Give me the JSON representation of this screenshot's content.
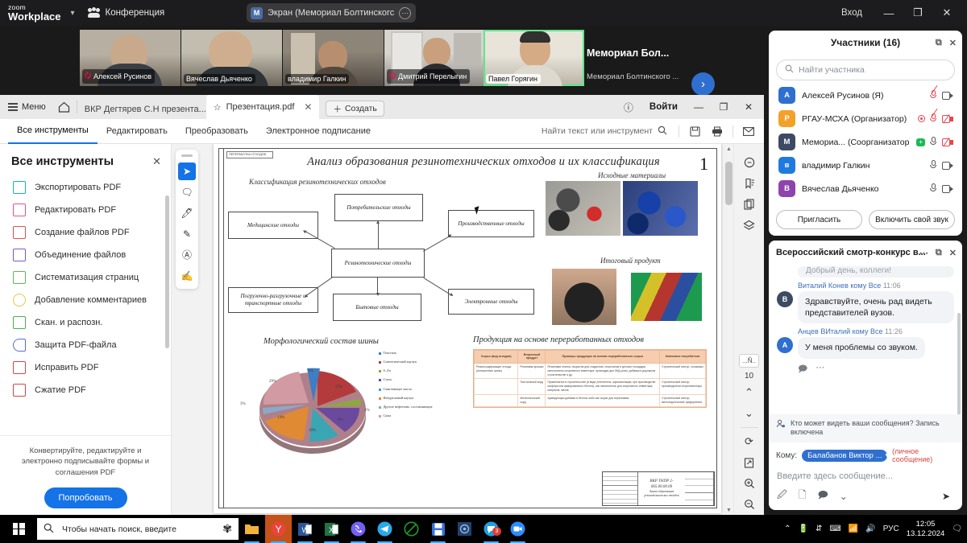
{
  "zoom_app": {
    "brand_line1": "zoom",
    "brand_line2": "Workplace",
    "meeting_label": "Конференция",
    "share_badge": "M",
    "share_label": "Экран (Мемориал Болтинскогс",
    "login_label": "Вход",
    "minimize": "—",
    "restore": "❐",
    "close": "✕",
    "filmstrip": [
      {
        "name": "Алексей Русинов",
        "muted": true,
        "active": false
      },
      {
        "name": "Вячеслав Дьяченко",
        "muted": false,
        "active": false
      },
      {
        "name": "владимир Галкин",
        "muted": false,
        "active": false
      },
      {
        "name": "Дмитрий Перелыгин",
        "muted": true,
        "active": false
      },
      {
        "name": "Павел Горягин",
        "muted": false,
        "active": true
      }
    ],
    "self_tile": {
      "title": "Мемориал  Бол...",
      "subtitle": "Мемориал Болтинского ..."
    },
    "next_arrow": "›"
  },
  "participants": {
    "title": "Участники (16)",
    "popout_icon": "popout-icon",
    "close_icon": "close-icon",
    "search_placeholder": "Найти участника",
    "rows": [
      {
        "initial": "А",
        "color": "#2f6fd0",
        "name": "Алексей Русинов (Я)",
        "recording": false,
        "host_badge": "",
        "mic": "muted",
        "cam": "on"
      },
      {
        "initial": "Р",
        "color": "#f2a12a",
        "name": "РГАУ-МСХА (Организатор)",
        "recording": true,
        "host_badge": "",
        "mic": "muted",
        "cam": "off"
      },
      {
        "initial": "М",
        "color": "#3d4a63",
        "name": "Мемориа...  (Соорганизатор)",
        "recording": false,
        "host_badge": "+",
        "mic": "on",
        "cam": "off"
      },
      {
        "initial": "в",
        "color": "#1f7ae0",
        "name": "владимир Галкин",
        "recording": false,
        "host_badge": "",
        "mic": "on",
        "cam": "on"
      },
      {
        "initial": "В",
        "color": "#8e44ad",
        "name": "Вячеслав Дьяченко",
        "recording": false,
        "host_badge": "",
        "mic": "on",
        "cam": "on"
      }
    ],
    "invite_button": "Пригласить",
    "unmute_button": "Включить свой звук"
  },
  "chat": {
    "title": "Всероссийский смотр-конкурс в...",
    "more_icon": "more-dots-icon",
    "popout_icon": "popout-icon",
    "close_icon": "close-icon",
    "clipped_message": "Добрый день, коллеги!",
    "messages": [
      {
        "author": "Виталий Конев",
        "to": "кому Все",
        "time": "11:06",
        "initial": "В",
        "color": "#3d4a63",
        "text": "Здравствуйте, очень рад видеть представителей вузов."
      },
      {
        "author": "Анцев ВИталий",
        "to": "кому Все",
        "time": "11:26",
        "initial": "А",
        "color": "#2f6fd0",
        "text": "У меня проблемы со звуком."
      }
    ],
    "privacy_note": "Кто может видеть ваши сообщения? Запись включена",
    "to_label": "Кому:",
    "recipient": "Балабанов Виктор ...",
    "private_note": "(личное сообщение)",
    "input_placeholder": "Введите здесь сообщение...",
    "send_icon": "send-icon"
  },
  "acrobat": {
    "menu_label": "Меню",
    "home_icon": "home-icon",
    "tabs": [
      {
        "label": "ВКР Дегтярев С.Н презента...",
        "active": false,
        "starred": false
      },
      {
        "label": "Презентация.pdf",
        "active": true,
        "starred": true
      }
    ],
    "new_button": "Создать",
    "help_icon": "help-icon",
    "signin_label": "Войти",
    "window_minimize": "—",
    "window_restore": "❐",
    "window_close": "✕",
    "toolbar_tabs": [
      {
        "label": "Все инструменты",
        "selected": true
      },
      {
        "label": "Редактировать",
        "selected": false
      },
      {
        "label": "Преобразовать",
        "selected": false
      },
      {
        "label": "Электронное подписание",
        "selected": false
      }
    ],
    "find_placeholder": "Найти текст или инструмент",
    "toolbar_icons": [
      "save-icon",
      "print-icon",
      "mail-icon"
    ],
    "tools_panel": {
      "title": "Все инструменты",
      "close_icon": "close-icon",
      "items": [
        {
          "label": "Экспортировать PDF",
          "color": "#12b5b0",
          "icon": "export-pdf-icon"
        },
        {
          "label": "Редактировать PDF",
          "color": "#e8518d",
          "icon": "edit-pdf-icon"
        },
        {
          "label": "Создание файлов PDF",
          "color": "#e34f4f",
          "icon": "create-pdf-icon"
        },
        {
          "label": "Объединение файлов",
          "color": "#6b5ce7",
          "icon": "combine-files-icon"
        },
        {
          "label": "Систематизация страниц",
          "color": "#5cb85c",
          "icon": "organize-pages-icon"
        },
        {
          "label": "Добавление комментариев",
          "color": "#e8c547",
          "icon": "comment-icon"
        },
        {
          "label": "Скан. и распозн.",
          "color": "#4caf50",
          "icon": "scan-ocr-icon"
        },
        {
          "label": "Защита PDF-файла",
          "color": "#5b6bd6",
          "icon": "protect-pdf-icon"
        },
        {
          "label": "Исправить PDF",
          "color": "#d64545",
          "icon": "fix-pdf-icon"
        },
        {
          "label": "Сжатие PDF",
          "color": "#d64545",
          "icon": "compress-pdf-icon"
        }
      ],
      "promo_text": "Конвертируйте, редактируйте и электронно подписывайте формы и соглашения PDF",
      "try_button": "Попробовать"
    },
    "annotation_tools": [
      {
        "icon": "select-cursor-icon",
        "selected": true
      },
      {
        "icon": "comment-bubble-icon",
        "selected": false
      },
      {
        "icon": "highlighter-icon",
        "selected": false
      },
      {
        "icon": "draw-freehand-icon",
        "selected": false
      },
      {
        "icon": "add-text-box-icon",
        "selected": false
      },
      {
        "icon": "signature-icon",
        "selected": false
      }
    ],
    "rail": {
      "icons": [
        "comment-icon",
        "bookmark-icon",
        "page-thumbnails-icon",
        "layers-icon"
      ],
      "page_field": "...Ñ..",
      "page_number": "10",
      "prev_icon": "chevron-up-icon",
      "next_icon": "chevron-down-icon",
      "rotate_icon": "rotate-icon",
      "fit_icon": "fit-page-icon",
      "zoom_in_icon": "zoom-in-icon",
      "zoom_out_icon": "zoom-out-icon"
    }
  },
  "document": {
    "stamp_top": "ПЕРЕРАБОТКА ОТХОДОВ",
    "title": "Анализ образования резинотехнических отходов и их классификация",
    "page_number": "1",
    "section_classification": "Классификация резинотехнических отходов",
    "section_materials": "Исходные материалы",
    "section_product": "Итоговый продукт",
    "section_pie": "Морфологический состав шины",
    "section_table": "Продукция на основе переработанных отходов",
    "diagram": {
      "center": "Резинотехнические отходы",
      "nodes": [
        "Потребительские отходы",
        "Медицинские отходы",
        "Производственные отходы",
        "Погрузочно-разгрузочные и транспортные отходы",
        "Бытовые отходы",
        "Электронные отходы"
      ]
    },
    "stamp_block": {
      "code": "ВКР ТНПР 2-065.00.00.00",
      "caption": "Анализ образования резинотехнических отходов"
    }
  },
  "chart_data": {
    "type": "pie",
    "title": "Морфологический состав шины",
    "categories": [
      "Текстиль",
      "Синтетический каучук",
      "S, Zn",
      "Сталь",
      "Смягчающее масло",
      "Натуральный каучук",
      "Другие нефтехим. составляющие",
      "Сажа"
    ],
    "values": [
      5,
      27,
      2,
      9,
      10,
      14,
      3,
      29
    ],
    "labels": [
      "5%",
      "27%",
      "2%",
      "9%",
      "10%",
      "14%",
      "3%",
      "29%"
    ],
    "colors": [
      "#3d7ec4",
      "#b43b3b",
      "#8aaa3c",
      "#6b4a9e",
      "#3aa5b3",
      "#e08a33",
      "#8aa9c9",
      "#d29aa3"
    ],
    "legend_position": "right",
    "exploded": true,
    "3d": true
  },
  "table_data": {
    "type": "table",
    "title": "Продукция на основе переработанных отходов",
    "columns": [
      "Сырье (вид отходов)",
      "Вторичный продукт",
      "Примеры продукции на основе переработанного сырья",
      "Ключевые потребители"
    ],
    "rows": [
      [
        "Резиносодержащие отходы (изношенные шины)",
        "Резиновая крошка",
        "Резиновая плитка, покрытия для стадионов, спортзалов и детских площадок, наполнитель спортивного инвентаря, прокладки для Ж/Д шпал, добавка в дорожном строительстве и др.",
        "Строительный сектор, госзаказы"
      ],
      [
        "",
        "Текстильный корд",
        "Применяется в строительстве (в виде утеплителя, шумоизоляции, при производстве шифера или армированного бетона), как наполнитель для спортивного инвентаря, матрасов, матов",
        "Строительный сектор, производители спортинвентаря"
      ],
      [
        "",
        "Металлический корд",
        "Армирующая добавка в бетоны либо как сырье для переплавки",
        "Строительный сектор, металлургические предприятия"
      ]
    ]
  },
  "taskbar": {
    "start_icon": "windows-start-icon",
    "search_placeholder": "Чтобы начать поиск, введите",
    "apps": [
      {
        "icon": "file-explorer-icon",
        "color": "#f2b33d",
        "active": true,
        "badge": ""
      },
      {
        "icon": "yandex-browser-icon",
        "color": "#e8443a",
        "active": true,
        "badge": ""
      },
      {
        "icon": "word-icon",
        "color": "#2b579a",
        "active": true,
        "badge": ""
      },
      {
        "icon": "excel-icon",
        "color": "#217346",
        "active": true,
        "badge": ""
      },
      {
        "icon": "viber-icon",
        "color": "#7360f2",
        "active": true,
        "badge": ""
      },
      {
        "icon": "telegram-icon",
        "color": "#29a9eb",
        "active": true,
        "badge": ""
      },
      {
        "icon": "antivirus-icon",
        "color": "#1f7a1f",
        "active": false,
        "badge": ""
      },
      {
        "icon": "save-app-icon",
        "color": "#3a6fd8",
        "active": true,
        "badge": ""
      },
      {
        "icon": "settings-app-icon",
        "color": "#3a5a8c",
        "active": false,
        "badge": ""
      },
      {
        "icon": "chat-app-icon",
        "color": "#1f9fe0",
        "active": true,
        "badge": "3"
      },
      {
        "icon": "zoom-app-icon",
        "color": "#2d8cff",
        "active": true,
        "badge": ""
      }
    ],
    "tray": {
      "chevron": "⌃",
      "icons": [
        "battery-icon",
        "usb-icon",
        "keyboard-icon",
        "wifi-icon",
        "volume-icon"
      ],
      "language": "РУС",
      "time": "12:05",
      "date": "13.12.2024",
      "notification_icon": "notification-icon"
    }
  }
}
